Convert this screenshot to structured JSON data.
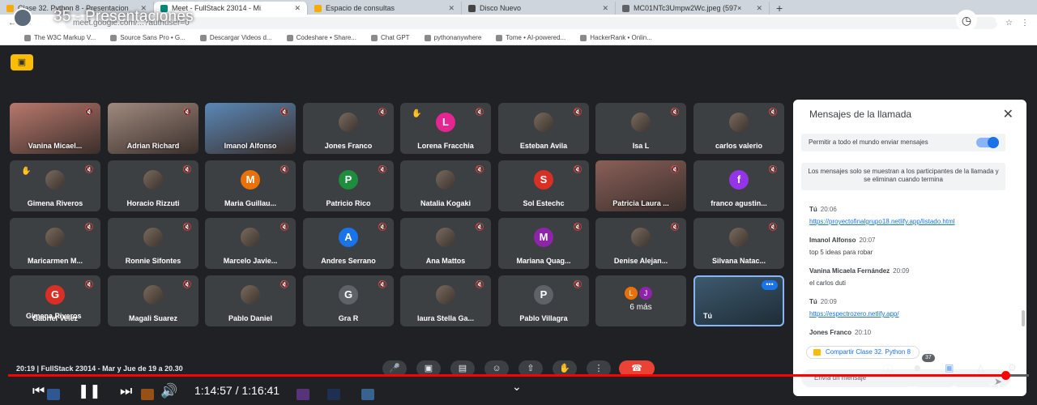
{
  "browser": {
    "tabs": [
      {
        "label": "Clase 32. Python 8 - Presentacion",
        "color": "#f9ab00"
      },
      {
        "label": "Meet - FullStack 23014 - Mi",
        "color": "#00897b",
        "active": true
      },
      {
        "label": "Espacio de consultas",
        "color": "#f9ab00"
      },
      {
        "label": "Disco Nuevo",
        "color": "#444444"
      },
      {
        "label": "MC01NTc3Umpw2Wc.jpeg (597×",
        "color": "#5f6368"
      }
    ],
    "url": "meet.google.com/...?authuser=0",
    "bookmarks": [
      "The W3C Markup V...",
      "Source Sans Pro • G...",
      "Descargar Videos d...",
      "Codeshare • Share...",
      "Chat GPT",
      "pythonanywhere",
      "Tome • AI-powered...",
      "HackerRank • Onlin..."
    ]
  },
  "video_title": "35 - Presentaciones",
  "participants": [
    {
      "name": "Vanina Micael...",
      "kind": "video",
      "tint": "#b9786c"
    },
    {
      "name": "Adrian Richard",
      "kind": "video",
      "tint": "#a08a7e"
    },
    {
      "name": "Imanol Alfonso",
      "kind": "video",
      "tint": "#5a88b8"
    },
    {
      "name": "Jones Franco",
      "kind": "photo"
    },
    {
      "name": "Lorena Fracchia",
      "kind": "letter",
      "letter": "L",
      "color": "#e52592",
      "hand": true
    },
    {
      "name": "Esteban Avila",
      "kind": "photo"
    },
    {
      "name": "Isa L",
      "kind": "photo"
    },
    {
      "name": "carlos valerio",
      "kind": "photo"
    },
    {
      "name": "Gimena Riveros",
      "kind": "photo",
      "hand": true
    },
    {
      "name": "Horacio Rizzuti",
      "kind": "photo"
    },
    {
      "name": "Maria Guillau...",
      "kind": "letter",
      "letter": "M",
      "color": "#e8710a"
    },
    {
      "name": "Patricio Rico",
      "kind": "letter",
      "letter": "P",
      "color": "#1e8e3e"
    },
    {
      "name": "Natalia Kogaki",
      "kind": "photo"
    },
    {
      "name": "Sol Estechc",
      "kind": "letter",
      "letter": "S",
      "color": "#d93025"
    },
    {
      "name": "Patricia Laura ...",
      "kind": "video",
      "tint": "#8a5f58"
    },
    {
      "name": "franco agustin...",
      "kind": "letter",
      "letter": "f",
      "color": "#9334e6"
    },
    {
      "name": "Maricarmen M...",
      "kind": "photo"
    },
    {
      "name": "Ronnie Sifontes",
      "kind": "photo"
    },
    {
      "name": "Marcelo Javie...",
      "kind": "photo"
    },
    {
      "name": "Andres Serrano",
      "kind": "letter",
      "letter": "A",
      "color": "#1a73e8"
    },
    {
      "name": "Ana Mattos",
      "kind": "photo"
    },
    {
      "name": "Mariana Quag...",
      "kind": "letter",
      "letter": "M",
      "color": "#8e24aa"
    },
    {
      "name": "Denise Alejan...",
      "kind": "photo"
    },
    {
      "name": "Silvana Natac...",
      "kind": "photo"
    },
    {
      "name": "Gabriel Velez",
      "kind": "letter",
      "letter": "G",
      "color": "#d93025"
    },
    {
      "name": "Magali Suarez",
      "kind": "photo"
    },
    {
      "name": "Pablo Daniel",
      "kind": "photo"
    },
    {
      "name": "Gra R",
      "kind": "letter",
      "letter": "G",
      "color": "#5f6368"
    },
    {
      "name": "laura Stella Ga...",
      "kind": "photo"
    },
    {
      "name": "Pablo Villagra",
      "kind": "letter",
      "letter": "P",
      "color": "#5f6368"
    }
  ],
  "overlay_name": "Gimena Riveros",
  "more_tile": {
    "label": "6 más",
    "letters": [
      "L",
      "J"
    ]
  },
  "self_tile": {
    "label": "Tú"
  },
  "chat": {
    "title": "Mensajes de la llamada",
    "permission": "Permitir a todo el mundo enviar mensajes",
    "notice": "Los mensajes solo se muestran a los participantes de la llamada y se eliminan cuando termina",
    "messages": [
      {
        "who": "Tú",
        "time": "20:06",
        "body": "https://proyectofinalgrupo18.netlify.app/listado.html",
        "link": true
      },
      {
        "who": "Imanol Alfonso",
        "time": "20:07",
        "body": "top 5 ideas para robar",
        "link": false
      },
      {
        "who": "Vanina Micaela Fernández",
        "time": "20:09",
        "body": "el carlos duti",
        "link": false
      },
      {
        "who": "Tú",
        "time": "20:09",
        "body": "https://espectrozero.netlify.app/",
        "link": true
      },
      {
        "who": "Jones Franco",
        "time": "20:10",
        "body": "",
        "link": false
      }
    ],
    "share_chip": "Compartir Clase 32. Python 8",
    "input_placeholder": "Envía un mensaje"
  },
  "meet_info": "20:19  |  FullStack 23014 - Mar y Jue de 19 a 20.30",
  "participant_count": "37",
  "player": {
    "time": "1:14:57 / 1:16:41",
    "progress": 0.977
  }
}
